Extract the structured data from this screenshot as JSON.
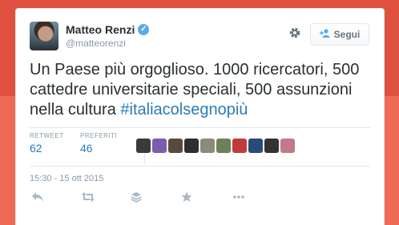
{
  "tweet": {
    "author_name": "Matteo Renzi",
    "handle": "@matteorenzi",
    "verified_mark": "✓",
    "follow_label": "Segui",
    "text_plain": "Un Paese più orgoglioso. 1000 ricercatori, 500 cattedre universitarie speciali, 500 assunzioni nella cultura ",
    "hashtag": "#italiacolsegnopiù",
    "retweet_label": "RETWEET",
    "retweet_count": "62",
    "favorites_label": "PREFERITI",
    "favorites_count": "46",
    "timestamp": "15:30 - 15 ott 2015"
  },
  "icons": {
    "settings": "gear-icon",
    "follow": "person-plus-icon",
    "reply": "reply-icon",
    "retweet": "retweet-icon",
    "buffer": "stack-icon",
    "favorite": "star-icon",
    "more": "more-dots-icon"
  },
  "colors": {
    "link": "#2b7bb9",
    "verified": "#55acee",
    "text": "#292f33",
    "muted": "#8899a6",
    "background": "#e85a4a"
  },
  "favorited_by_avatars": [
    {
      "color": "#3b3a3a"
    },
    {
      "color": "#7a5cb0"
    },
    {
      "color": "#5a4a3e"
    },
    {
      "color": "#2e2e2e"
    },
    {
      "color": "#8b8b7a"
    },
    {
      "color": "#6e7f5a"
    },
    {
      "color": "#c23b3b"
    },
    {
      "color": "#2a4a7a"
    },
    {
      "color": "#333333"
    },
    {
      "color": "#c07a8a"
    }
  ]
}
